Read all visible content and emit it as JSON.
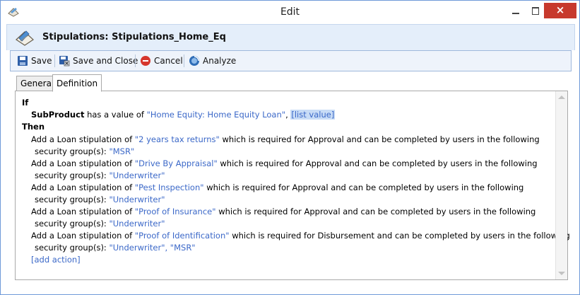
{
  "window": {
    "title": "Edit",
    "close_glyph": "×"
  },
  "header": {
    "title": "Stipulations: Stipulations_Home_Eq",
    "icon": "stipulation-document-icon"
  },
  "toolbar": {
    "save": "Save",
    "save_close": "Save and Close",
    "cancel": "Cancel",
    "analyze": "Analyze"
  },
  "tabs": [
    {
      "label": "General",
      "active": false
    },
    {
      "label": "Definition",
      "active": true
    }
  ],
  "rule": {
    "if_label": "If",
    "condition_field": "SubProduct",
    "condition_text": "has a value of",
    "condition_value": "\"Home Equity: Home Equity Loan\"",
    "condition_sep": ",",
    "list_value_link": "[list value]",
    "then_label": "Then",
    "actions": [
      {
        "prefix": "Add a Loan stipulation of",
        "stipulation": "\"2 years tax returns\"",
        "mid": "which is required for Approval and can be completed by users in the following",
        "groups_label": "security group(s):",
        "groups": "\"MSR\""
      },
      {
        "prefix": "Add a Loan stipulation of",
        "stipulation": "\"Drive By Appraisal\"",
        "mid": "which is required for Approval and can be completed by users in the following",
        "groups_label": "security group(s):",
        "groups": "\"Underwriter\""
      },
      {
        "prefix": "Add a  Loan stipulation of",
        "stipulation": "\"Pest Inspection\"",
        "mid": "which is required for Approval and can be completed by users in the following",
        "groups_label": "security group(s):",
        "groups": "\"Underwriter\""
      },
      {
        "prefix": "Add a Loan stipulation of",
        "stipulation": "\"Proof of Insurance\"",
        "mid": "which is required for Approval and can be completed by users in the following",
        "groups_label": "security group(s):",
        "groups": "\"Underwriter\""
      },
      {
        "prefix": "Add a Loan stipulation of",
        "stipulation": "\"Proof of Identification\"",
        "mid": "which is required for Disbursement and can be completed by users in the following",
        "groups_label": "security group(s):",
        "groups": "\"Underwriter\", \"MSR\""
      }
    ],
    "add_action_link": "[add action]"
  },
  "colors": {
    "value_blue": "#3b68c8",
    "header_bg": "#e4eefa",
    "close_red": "#c7392d",
    "border_blue": "#6f9ad8"
  }
}
